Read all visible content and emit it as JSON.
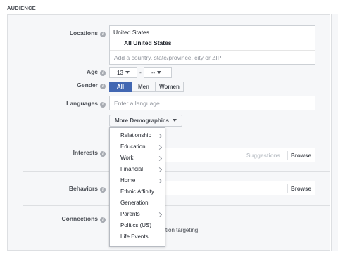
{
  "section_title": "AUDIENCE",
  "locations": {
    "label": "Locations",
    "country": "United States",
    "scope": "All United States",
    "placeholder": "Add a country, state/province, city or ZIP"
  },
  "age": {
    "label": "Age",
    "min": "13",
    "separator": "-",
    "max": "--"
  },
  "gender": {
    "label": "Gender",
    "options": [
      "All",
      "Men",
      "Women"
    ],
    "selected": "All"
  },
  "languages": {
    "label": "Languages",
    "placeholder": "Enter a language..."
  },
  "more_demographics": {
    "label": "More Demographics",
    "menu": [
      "Relationship",
      "Education",
      "Work",
      "Financial",
      "Home",
      "Ethnic Affinity",
      "Generation",
      "Parents",
      "Politics (US)",
      "Life Events"
    ],
    "has_submenu": [
      true,
      true,
      true,
      true,
      true,
      false,
      false,
      true,
      false,
      false
    ]
  },
  "interests": {
    "label": "Interests",
    "suggestions": "Suggestions",
    "browse": "Browse"
  },
  "behaviors": {
    "label": "Behaviors",
    "browse": "Browse"
  },
  "connections": {
    "label": "Connections",
    "partial_text": "ction targeting"
  },
  "colors": {
    "accent": "#4267b2",
    "panel_bg": "#f6f7f9",
    "border": "#dddfe2"
  }
}
